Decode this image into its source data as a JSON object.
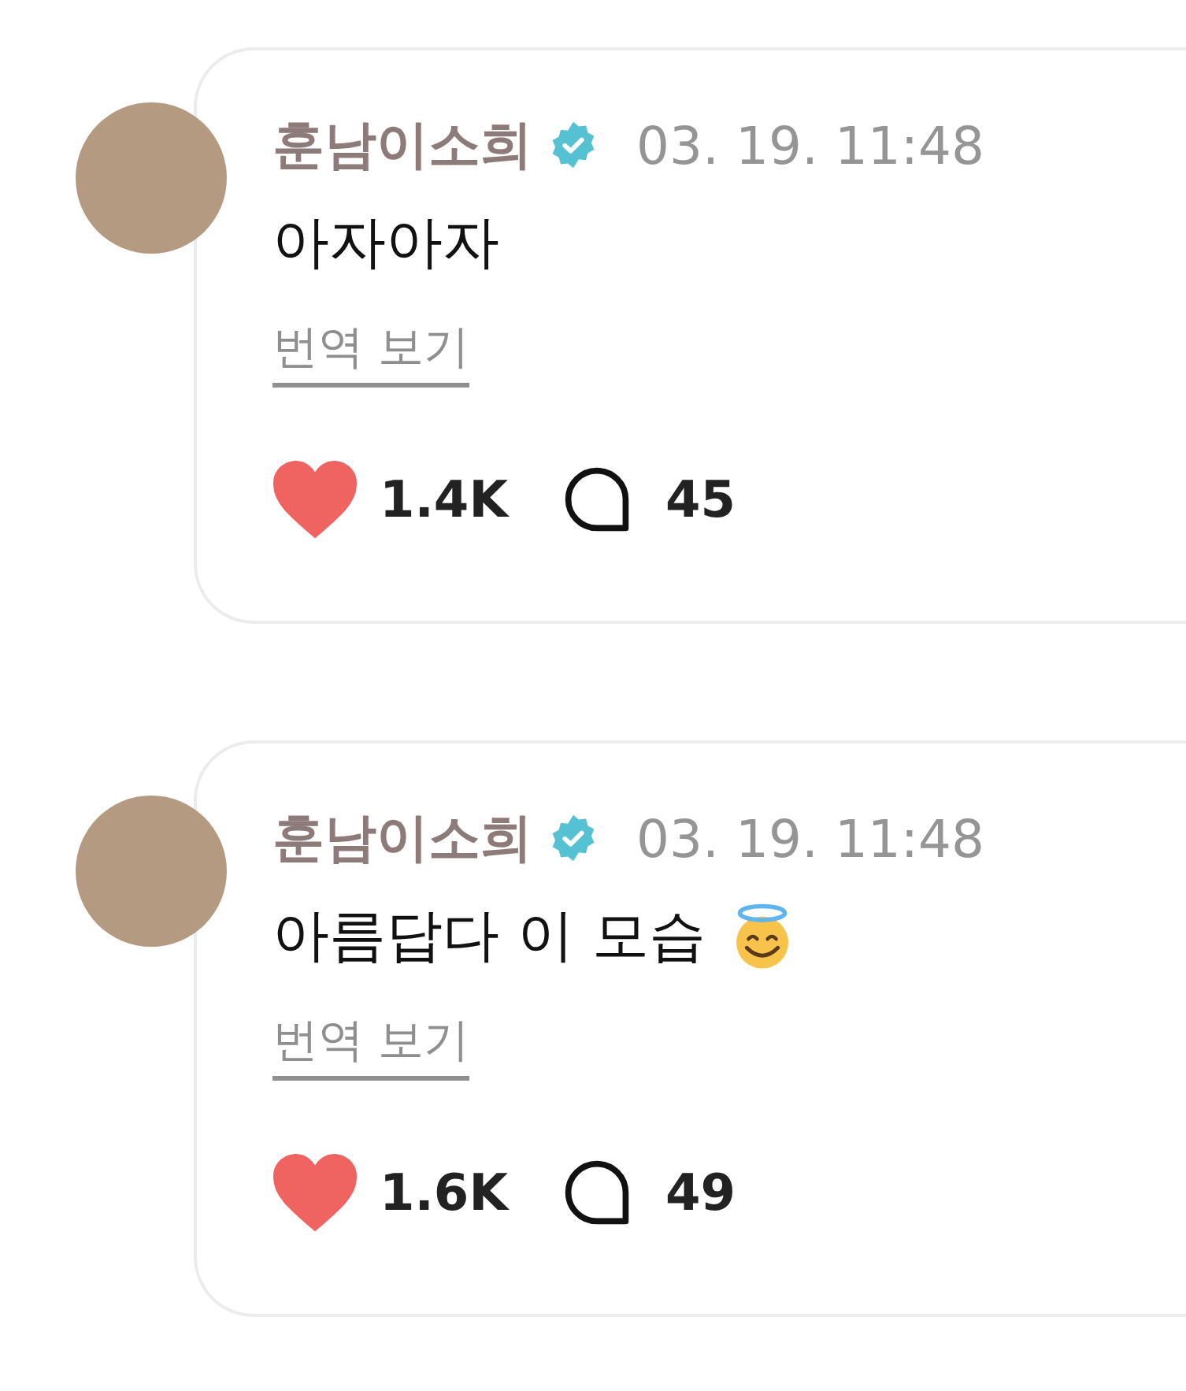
{
  "comments": [
    {
      "author": "훈남이소희",
      "verified": true,
      "time": "03. 19. 11:48",
      "text": "아자아자",
      "emoji": false,
      "translate": "번역 보기",
      "liked": true,
      "likes": "1.4K",
      "replies": "45"
    },
    {
      "author": "훈남이소희",
      "verified": true,
      "time": "03. 19. 11:48",
      "text": "아름답다 이 모습",
      "emoji": true,
      "translate": "번역 보기",
      "liked": true,
      "likes": "1.6K",
      "replies": "49"
    }
  ]
}
